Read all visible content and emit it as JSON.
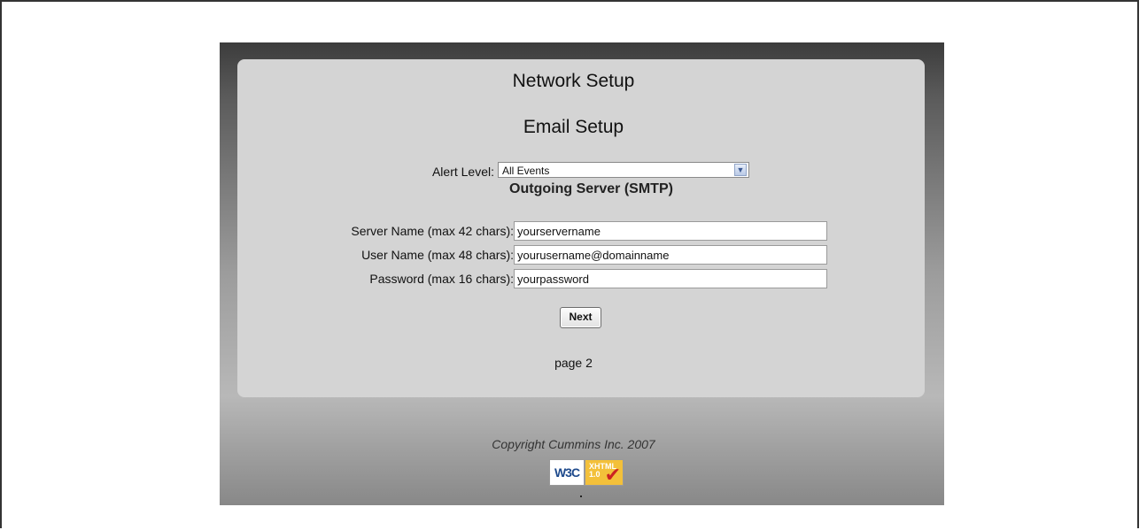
{
  "header": {
    "title": "Network Setup",
    "subtitle": "Email Setup"
  },
  "alert": {
    "label": "Alert Level:",
    "selected": "All Events"
  },
  "smtp": {
    "section_title": "Outgoing Server (SMTP)",
    "fields": [
      {
        "label": "Server Name (max 42 chars):",
        "value": "yourservername"
      },
      {
        "label": "User Name (max 48 chars):",
        "value": "yourusername@domainname"
      },
      {
        "label": "Password (max 16 chars):",
        "value": "yourpassword"
      }
    ]
  },
  "actions": {
    "next_label": "Next"
  },
  "footer": {
    "page": "page 2",
    "copyright": "Copyright Cummins Inc. 2007",
    "badge_left": "W3C",
    "badge_right_line1": "XHTML",
    "badge_right_line2": "1.0",
    "badge_icon": "checkmark-icon"
  },
  "colors": {
    "panel": "#d4d4d4",
    "badge_yellow": "#f3c03a",
    "check_red": "#cc2222"
  }
}
